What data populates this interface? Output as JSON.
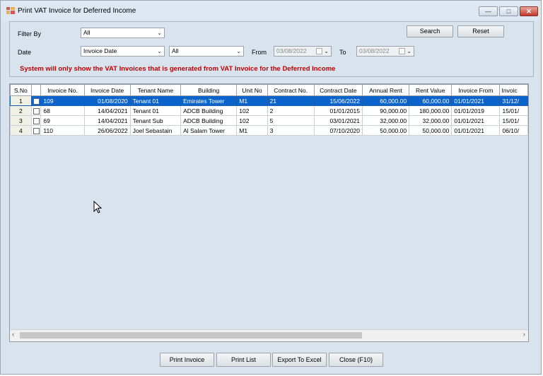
{
  "window": {
    "title": "Print VAT Invoice for Deferred Income",
    "icon": "app-icon"
  },
  "filters": {
    "filter_by_label": "Filter By",
    "filter_by_value": "All",
    "date_label": "Date",
    "date_type_value": "Invoice Date",
    "date_range_value": "All",
    "from_label": "From",
    "from_value": "03/08/2022",
    "to_label": "To",
    "to_value": "03/08/2022",
    "search_label": "Search",
    "reset_label": "Reset",
    "notice": "System will only show the VAT Invoices that is generated from VAT Invoice for the Deferred Income"
  },
  "grid": {
    "columns": [
      "S.No",
      "",
      "Invoice No.",
      "Invoice Date",
      "Tenant Name",
      "Building",
      "Unit No",
      "Contract No.",
      "Contract Date",
      "Annual Rent",
      "Rent Value",
      "Invoice From",
      "Invoic"
    ],
    "rows": [
      {
        "sno": "1",
        "invoice_no": "109",
        "invoice_date": "01/08/2020",
        "tenant": "Tenant 01",
        "building": "Emirates Tower",
        "unit": "M1",
        "contract_no": "21",
        "contract_date": "15/06/2022",
        "annual_rent": "60,000.00",
        "rent_value": "60,000.00",
        "invoice_from": "01/01/2021",
        "invoice_to": "31/12/"
      },
      {
        "sno": "2",
        "invoice_no": "68",
        "invoice_date": "14/04/2021",
        "tenant": "Tenant 01",
        "building": "ADCB Building",
        "unit": "102",
        "contract_no": "2",
        "contract_date": "01/01/2015",
        "annual_rent": "90,000.00",
        "rent_value": "180,000.00",
        "invoice_from": "01/01/2019",
        "invoice_to": "15/01/"
      },
      {
        "sno": "3",
        "invoice_no": "69",
        "invoice_date": "14/04/2021",
        "tenant": "Tenant Sub",
        "building": "ADCB Building",
        "unit": "102",
        "contract_no": "5",
        "contract_date": "03/01/2021",
        "annual_rent": "32,000.00",
        "rent_value": "32,000.00",
        "invoice_from": "01/01/2021",
        "invoice_to": "15/01/"
      },
      {
        "sno": "4",
        "invoice_no": "110",
        "invoice_date": "26/06/2022",
        "tenant": "Joel Sebastain",
        "building": "Al Salam Tower",
        "unit": "M1",
        "contract_no": "3",
        "contract_date": "07/10/2020",
        "annual_rent": "50,000.00",
        "rent_value": "50,000.00",
        "invoice_from": "01/01/2021",
        "invoice_to": "06/10/"
      }
    ]
  },
  "footer": {
    "print_invoice": "Print Invoice",
    "print_list": "Print List",
    "export_excel": "Export To Excel",
    "close": "Close (F10)"
  },
  "colors": {
    "selection": "#0a64cc",
    "notice": "#c00000",
    "panel": "#d9e3ee"
  }
}
